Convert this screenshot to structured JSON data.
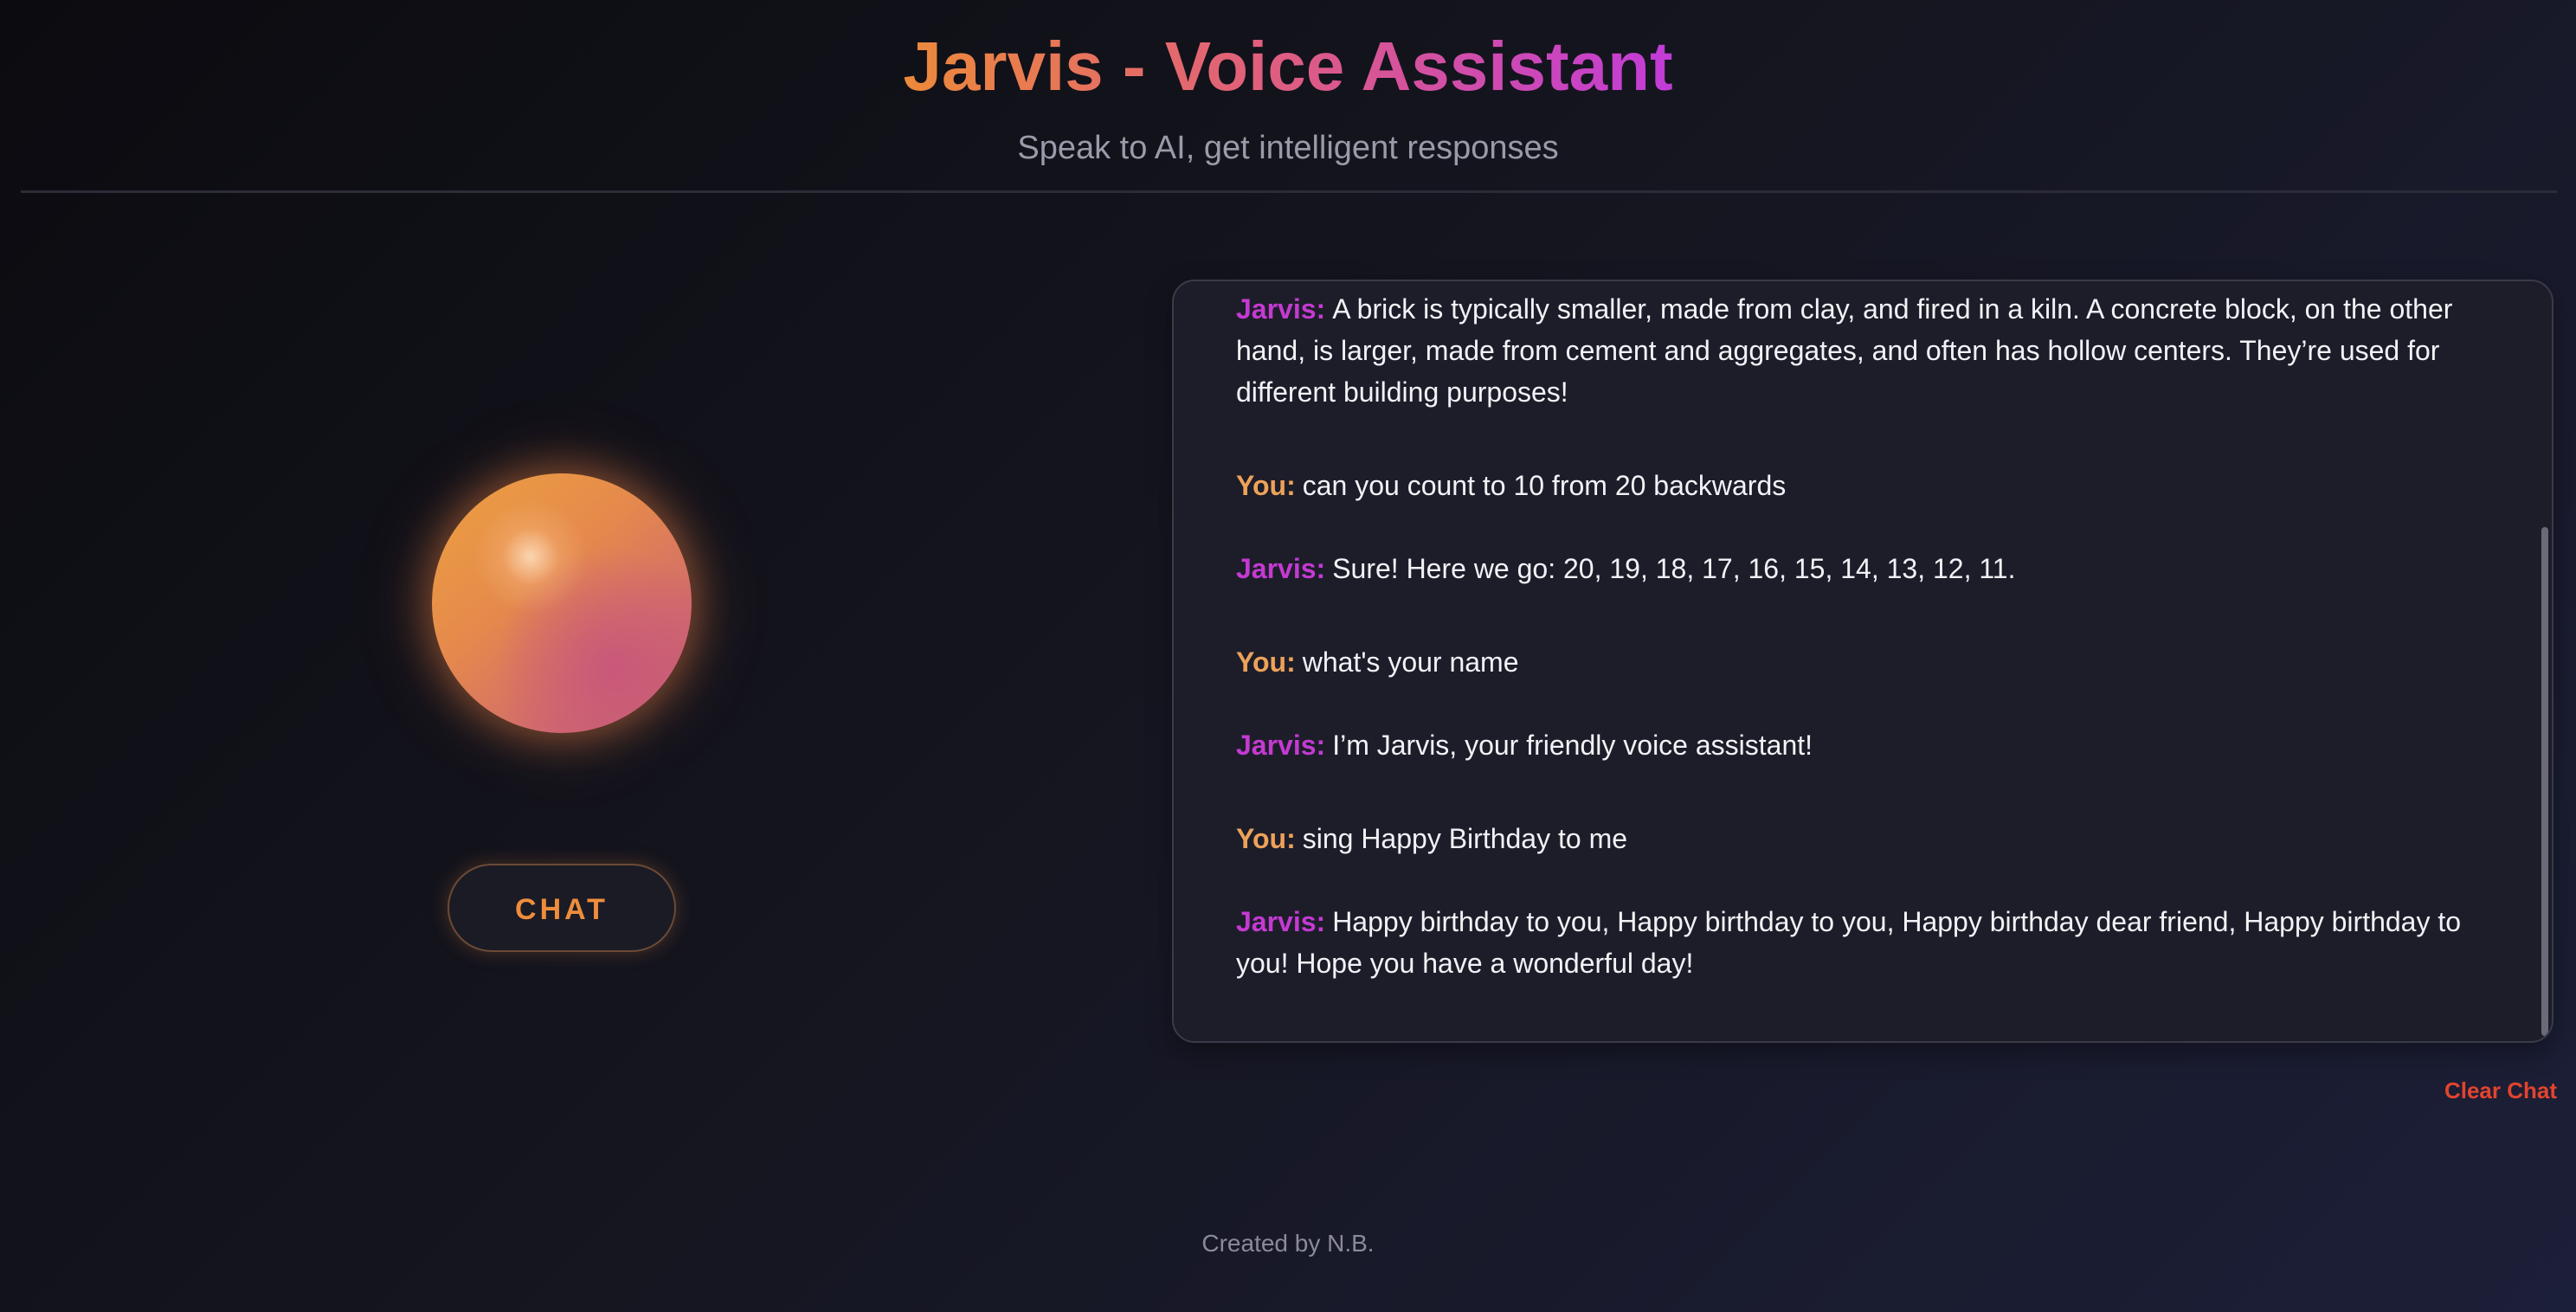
{
  "header": {
    "title": "Jarvis - Voice Assistant",
    "subtitle": "Speak to AI, get intelligent responses"
  },
  "controls": {
    "chat_button_label": "CHAT",
    "clear_chat_label": "Clear Chat"
  },
  "conversation": {
    "messages": [
      {
        "speaker": "Jarvis:",
        "text": "A brick is typically smaller, made from clay, and fired in a kiln. A concrete block, on the other hand, is larger, made from cement and aggregates, and often has hollow centers. They’re used for different building purposes!"
      },
      {
        "speaker": "You:",
        "text": "can you count to 10 from 20 backwards"
      },
      {
        "speaker": "Jarvis:",
        "text": "Sure! Here we go: 20, 19, 18, 17, 16, 15, 14, 13, 12, 11."
      },
      {
        "speaker": "You:",
        "text": "what's your name"
      },
      {
        "speaker": "Jarvis:",
        "text": "I’m Jarvis, your friendly voice assistant!"
      },
      {
        "speaker": "You:",
        "text": "sing Happy Birthday to me"
      },
      {
        "speaker": "Jarvis:",
        "text": "Happy birthday to you, Happy birthday to you, Happy birthday dear friend, Happy birthday to you! Hope you have a wonderful day!"
      }
    ]
  },
  "footer": {
    "credit": "Created by N.B."
  },
  "colors": {
    "jarvis_label": "#c43ad2",
    "you_label": "#eda25a",
    "accent_orange": "#ef8d3c",
    "clear_red": "#e2442e"
  }
}
